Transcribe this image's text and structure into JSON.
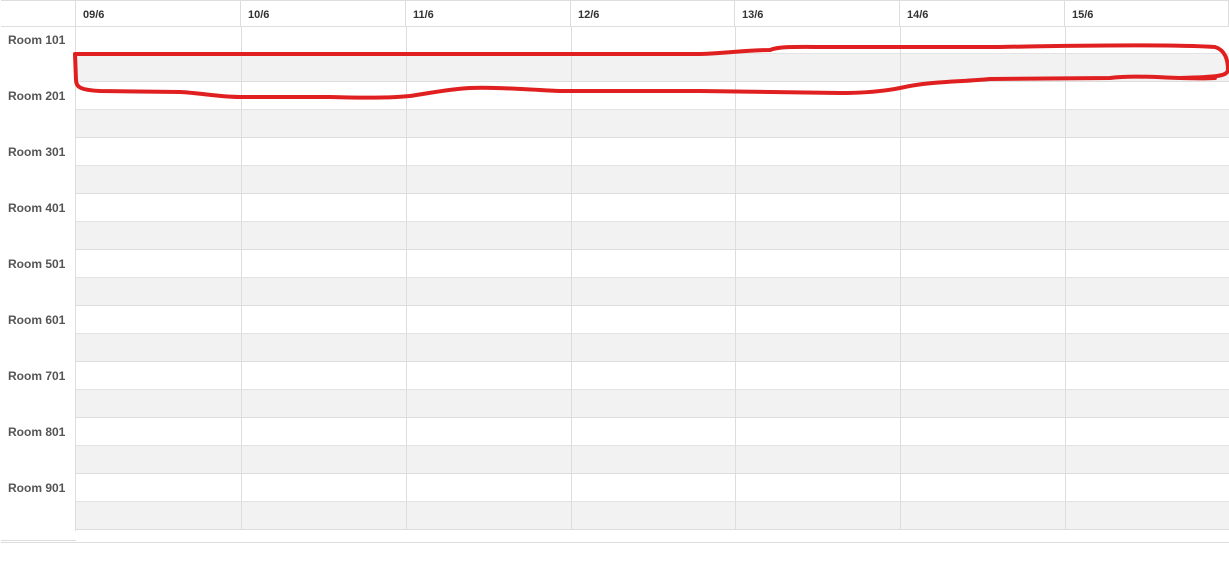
{
  "days": [
    "09/6",
    "10/6",
    "11/6",
    "12/6",
    "13/6",
    "14/6",
    "15/6"
  ],
  "rooms": [
    "Room 101",
    "Room 201",
    "Room 301",
    "Room 401",
    "Room 501",
    "Room 601",
    "Room 701",
    "Room 801",
    "Room 901"
  ],
  "annotation": {
    "color": "#e02020"
  }
}
